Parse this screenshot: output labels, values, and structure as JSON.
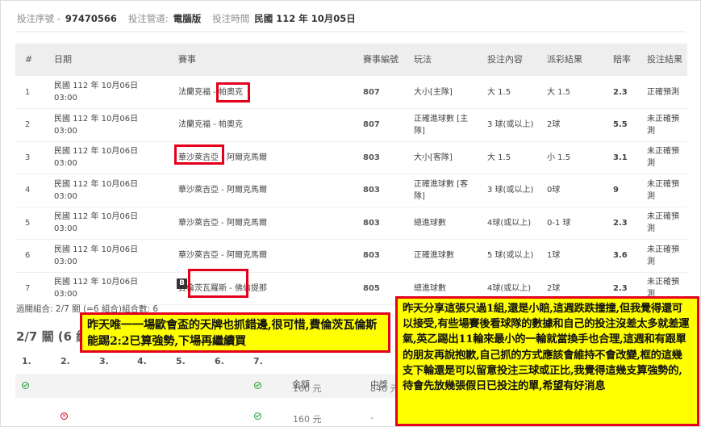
{
  "header": {
    "serial_label": "投注序號 -",
    "serial_value": "97470566",
    "channel_label": "投注管道:",
    "channel_value": "電腦版",
    "time_label": "投注時間",
    "time_value": "民國 112 年 10月05日"
  },
  "table": {
    "columns": [
      "#",
      "日期",
      "賽事",
      "賽事編號",
      "玩法",
      "投注內容",
      "派彩結果",
      "賠率",
      "投注結果"
    ],
    "rows": [
      {
        "idx": "1",
        "date": "民國 112 年 10月06日 03:00",
        "event": "法蘭克福 - 帕奧克",
        "code": "807",
        "play": "大小[主隊]",
        "content": "大 1.5",
        "payout": "大 1.5",
        "odds": "2.3",
        "result": "正確預測"
      },
      {
        "idx": "2",
        "date": "民國 112 年 10月06日 03:00",
        "event": "法蘭克福 - 帕奧克",
        "code": "807",
        "play": "正確進球數 [主隊]",
        "content": "3 球(或以上)",
        "payout": "2球",
        "odds": "5.5",
        "result": "未正確預測"
      },
      {
        "idx": "3",
        "date": "民國 112 年 10月06日 03:00",
        "event": "華沙萊吉亞 - 阿爾克馬爾",
        "code": "803",
        "play": "大小[客隊]",
        "content": "大 1.5",
        "payout": "小 1.5",
        "odds": "3.1",
        "result": "未正確預測"
      },
      {
        "idx": "4",
        "date": "民國 112 年 10月06日 03:00",
        "event": "華沙萊吉亞 - 阿爾克馬爾",
        "code": "803",
        "play": "正確進球數 [客隊]",
        "content": "3 球(或以上)",
        "payout": "0球",
        "odds": "9",
        "result": "未正確預測"
      },
      {
        "idx": "5",
        "date": "民國 112 年 10月06日 03:00",
        "event": "華沙萊吉亞 - 阿爾克馬爾",
        "code": "803",
        "play": "總進球數",
        "content": "4球(或以上)",
        "payout": "0-1 球",
        "odds": "2.3",
        "result": "未正確預測"
      },
      {
        "idx": "6",
        "date": "民國 112 年 10月06日 03:00",
        "event": "華沙萊吉亞 - 阿爾克馬爾",
        "code": "803",
        "play": "正確進球數",
        "content": "5 球(或以上)",
        "payout": "1球",
        "odds": "3.6",
        "result": "未正確預測"
      },
      {
        "idx": "7",
        "date": "民國 112 年 10月06日 03:00",
        "event": "費倫茨瓦羅斯 - 佛倫提那",
        "code": "805",
        "play": "總進球數",
        "content": "4球(或以上)",
        "payout": "2球",
        "odds": "2.3",
        "result": "未正確預測"
      }
    ],
    "badge_b": "B"
  },
  "summary": "過關組合: 2/7 關 (=6 組合)組合數: 6",
  "section_title": "2/7 關 (6 組",
  "grid": {
    "headers": [
      "1.",
      "2.",
      "3.",
      "4.",
      "5.",
      "6.",
      "7."
    ],
    "sub_amount": "金額",
    "sub_win": "中獎",
    "rows": [
      {
        "amount": "160 元",
        "win": "846 元"
      },
      {
        "amount": "160 元",
        "win": "-"
      }
    ]
  },
  "notes": {
    "left": "昨天唯一一場歐會盃的天牌也抓錯邊,很可惜,費倫茨瓦倫斯能踢2:2已算強勢,下場再繼續買",
    "right": "昨天分享這張只過1組,還是小賠,這週跌跌撞撞,但我覺得還可以接受,有些場賽後看球隊的數據和自己的投注沒差太多就差運氣,英乙踢出11輪來最小的一輪就當換手也合理,這週和有跟單的朋友再說抱歉,自己抓的方式應該會維持不會改變,框的這幾支下輪還是可以留意投注三球或正比,我覺得這幾支算強勢的,待會先放幾張假日已投注的單,希望有好消息"
  },
  "colors": {
    "highlight_red": "#e3001b",
    "note_yellow": "#ffff00",
    "ok_green": "#2e9c3a"
  }
}
